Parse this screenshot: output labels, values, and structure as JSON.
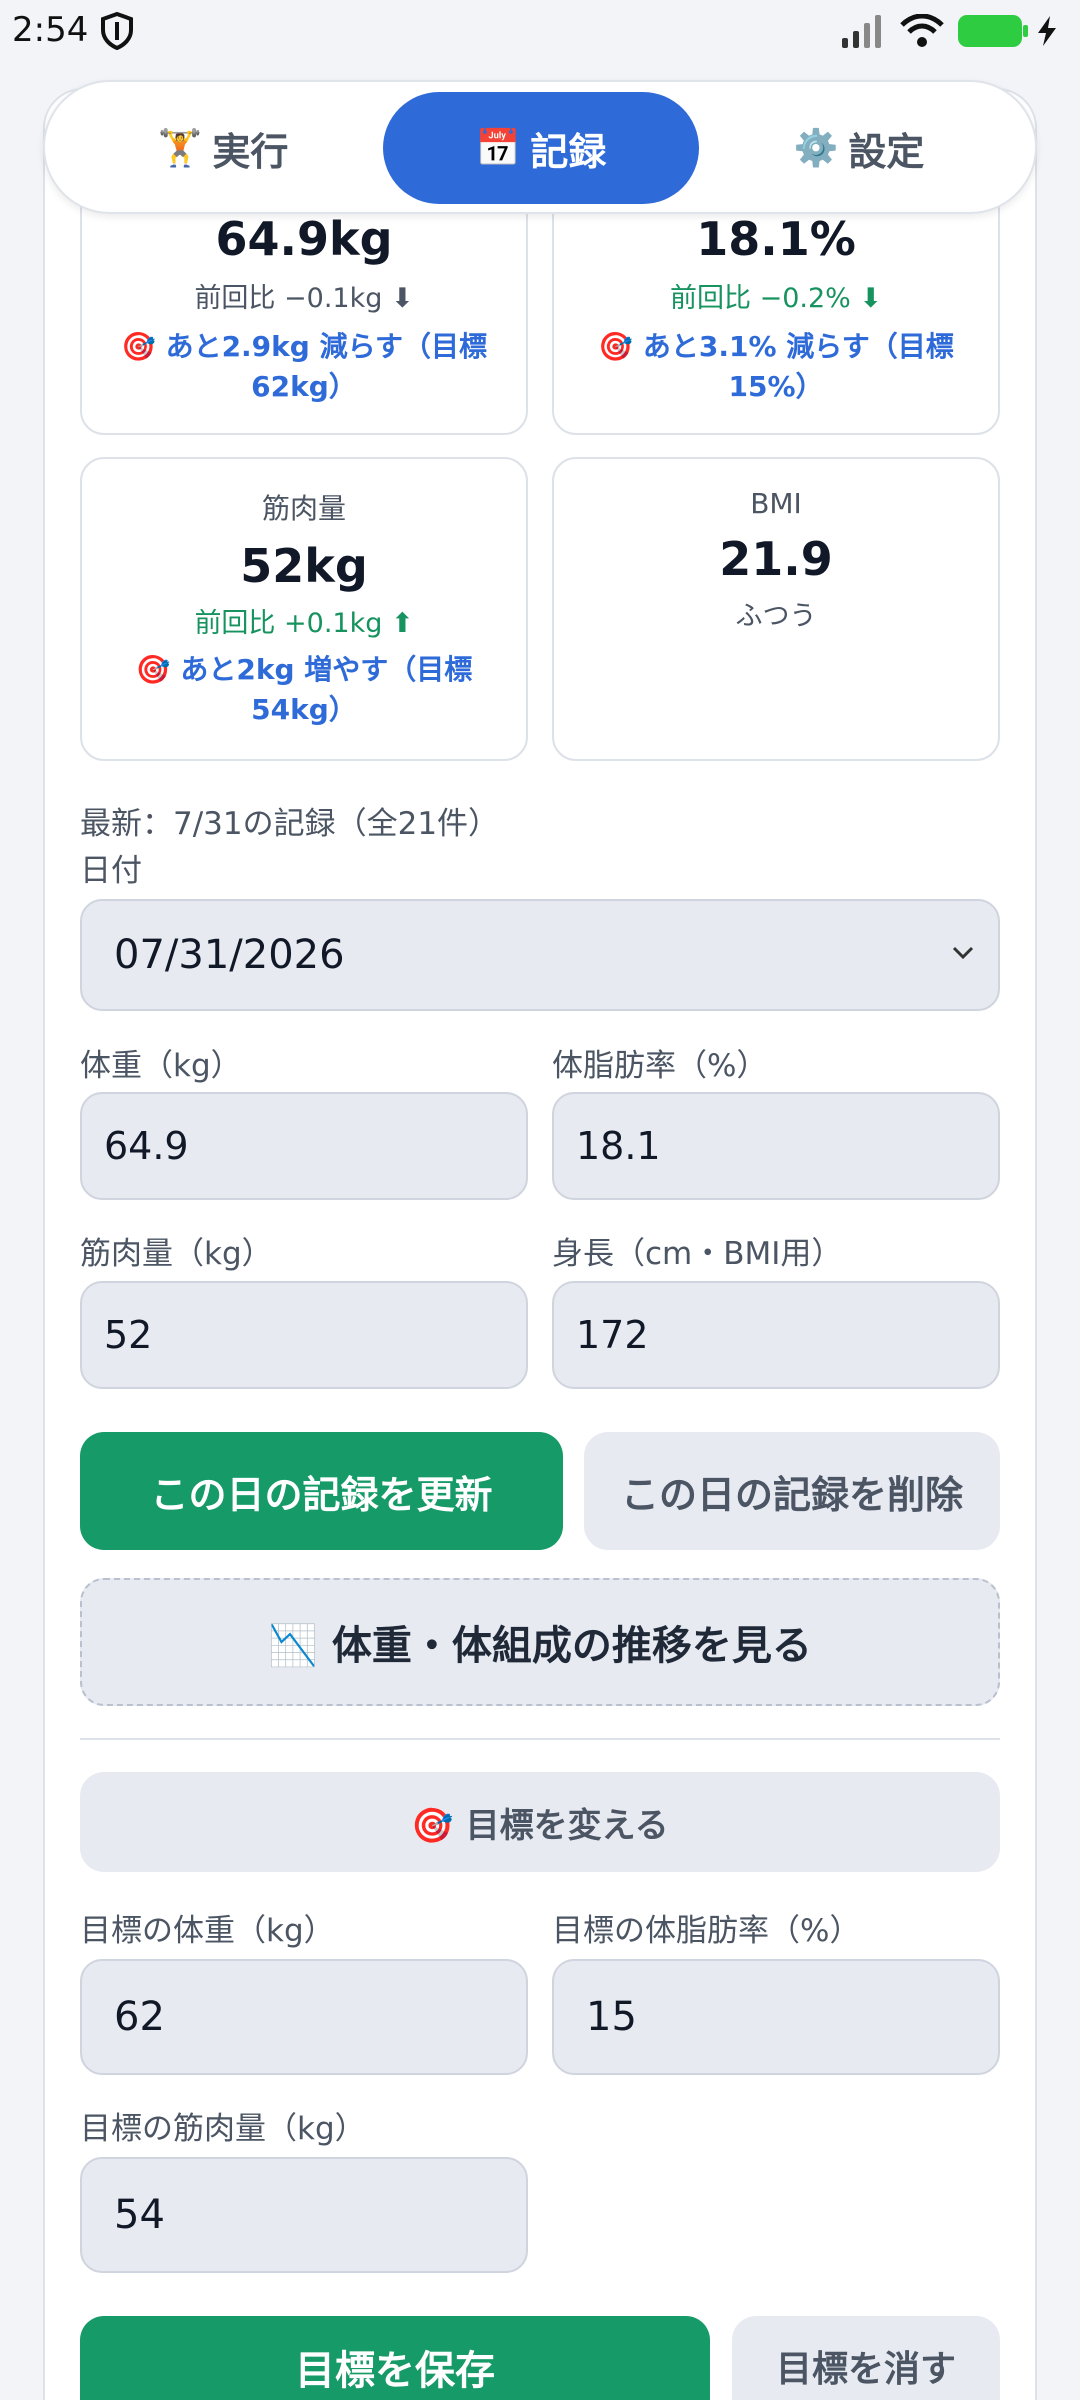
{
  "status_bar": {
    "time": "2:54"
  },
  "tabs": [
    {
      "icon": "🏋",
      "label": "実行"
    },
    {
      "icon": "📅",
      "label": "記録"
    },
    {
      "icon": "⚙️",
      "label": "設定"
    }
  ],
  "stats": {
    "weight": {
      "value": "64.9kg",
      "delta": "前回比 −0.1kg ⬇",
      "goal": "🎯 あと2.9kg 減らす（目標62kg）"
    },
    "body_fat": {
      "value": "18.1%",
      "delta": "前回比 −0.2% ⬇",
      "goal": "🎯 あと3.1% 減らす（目標15%）"
    },
    "muscle": {
      "label": "筋肉量",
      "value": "52kg",
      "delta": "前回比 +0.1kg ⬆",
      "goal": "🎯 あと2kg 増やす（目標54kg）"
    },
    "bmi": {
      "label": "BMI",
      "value": "21.9",
      "status": "ふつう"
    }
  },
  "latest_note": "最新：7/31の記録（全21件）",
  "form": {
    "date_label": "日付",
    "date_value": "07/31/2026",
    "weight_label": "体重（kg）",
    "weight_value": "64.9",
    "fat_label": "体脂肪率（%）",
    "fat_value": "18.1",
    "muscle_label": "筋肉量（kg）",
    "muscle_value": "52",
    "height_label": "身長（cm・BMI用）",
    "height_value": "172"
  },
  "buttons": {
    "update": "この日の記録を更新",
    "delete": "この日の記録を削除",
    "trend": "📉 体重・体組成の推移を見る",
    "change_goal": "🎯 目標を変える",
    "save_goal": "目標を保存",
    "clear_goal": "目標を消す"
  },
  "goal_form": {
    "weight_label": "目標の体重（kg）",
    "weight_value": "62",
    "fat_label": "目標の体脂肪率（%）",
    "fat_value": "15",
    "muscle_label": "目標の筋肉量（kg）",
    "muscle_value": "54"
  }
}
